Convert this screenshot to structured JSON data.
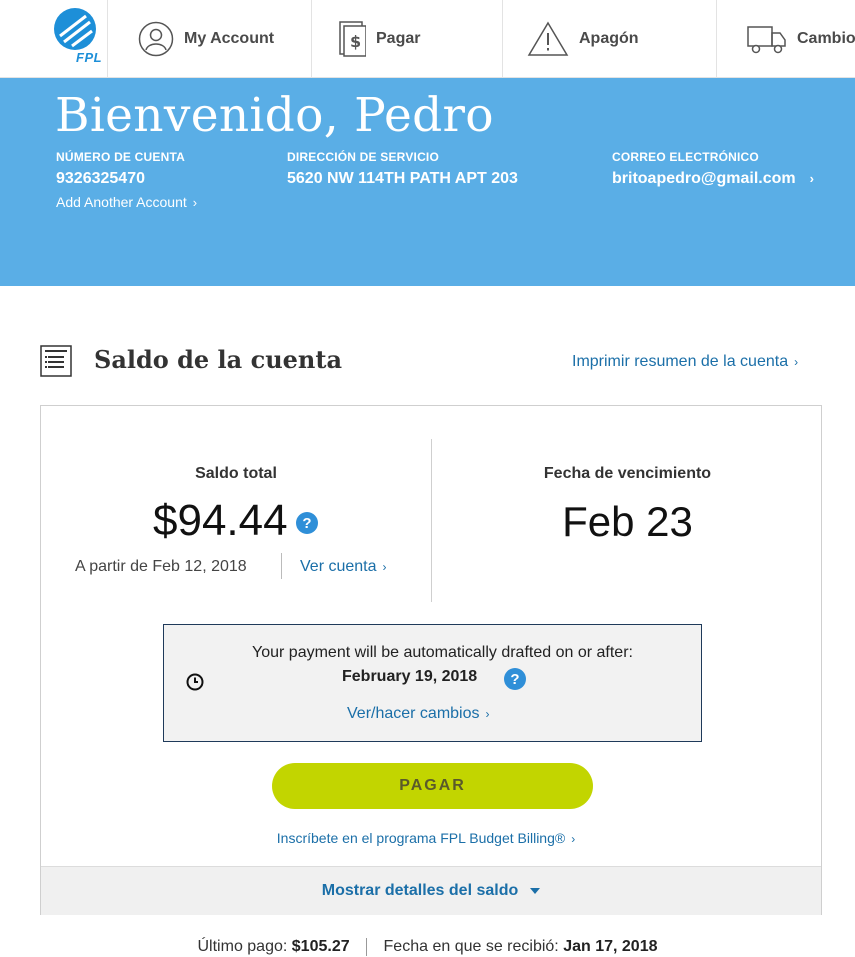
{
  "nav": {
    "logo_text": "FPL",
    "items": [
      {
        "label": "My Account",
        "icon": "user-icon"
      },
      {
        "label": "Pagar",
        "icon": "dollar-bill-icon"
      },
      {
        "label": "Apagón",
        "icon": "warning-icon"
      },
      {
        "label": "Cambio",
        "icon": "truck-icon"
      }
    ]
  },
  "header": {
    "greeting": "Bienvenido, Pedro",
    "account_label": "NÚMERO DE CUENTA",
    "account_number": "9326325470",
    "add_account": "Add Another Account",
    "service_label": "DIRECCIÓN DE SERVICIO",
    "service_address": "5620 NW 114TH PATH APT 203",
    "email_label": "CORREO ELECTRÓNICO",
    "email": "britoapedro@gmail.com",
    "colors": {
      "background": "#5aaee6"
    }
  },
  "section": {
    "title": "Saldo de la cuenta",
    "print_link": "Imprimir resumen de la cuenta"
  },
  "balance": {
    "total_label": "Saldo total",
    "amount": "$94.44",
    "as_of": "A partir de Feb 12, 2018",
    "view_account": "Ver cuenta",
    "due_label": "Fecha de vencimiento",
    "due_date": "Feb 23",
    "help_glyph": "?"
  },
  "autopay": {
    "line1": "Your payment will be automatically drafted on or after:",
    "date": "February 19, 2018",
    "link": "Ver/hacer cambios"
  },
  "pay_button": {
    "label": "PAGAR",
    "color": "#c2d500"
  },
  "budget_link": "Inscríbete en el programa FPL Budget Billing®",
  "details_toggle": "Mostrar detalles del saldo",
  "last_payment": {
    "label": "Último pago:",
    "amount": "$105.27",
    "received_label": "Fecha en que se recibió:",
    "received_date": "Jan 17, 2018"
  },
  "chevron": "›"
}
